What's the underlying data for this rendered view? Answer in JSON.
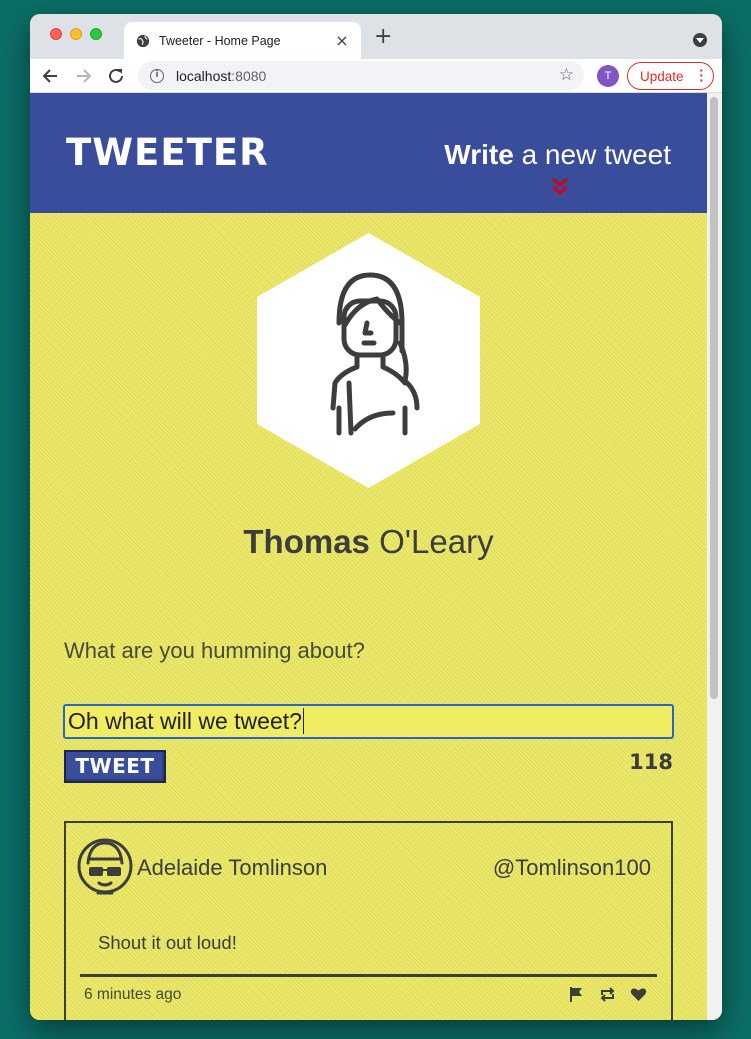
{
  "browser": {
    "tab_title": "Tweeter - Home Page",
    "tab_close": "×",
    "new_tab": "+",
    "url_host": "localhost",
    "url_port": ":8080",
    "info_glyph": "i",
    "star_glyph": "☆",
    "profile_initial": "T",
    "update_label": "Update",
    "update_menu": "⋮"
  },
  "header": {
    "logo": "TWEETER",
    "write_bold": "Write",
    "write_rest": " a new tweet",
    "chevron_icon": "double-chevron-down-icon",
    "chevron_color": "#d0021b"
  },
  "profile": {
    "first_name": "Thomas",
    "last_name": " O'Leary"
  },
  "compose": {
    "label": "What are you humming about?",
    "value": "Oh what will we tweet?",
    "button_label": "TWEET",
    "char_count": "118"
  },
  "tweets": [
    {
      "author": "Adelaide Tomlinson",
      "handle": "@Tomlinson100",
      "body": "Shout it out loud!",
      "time": "6 minutes ago",
      "actions": [
        "flag-icon",
        "retweet-icon",
        "heart-icon"
      ]
    }
  ],
  "colors": {
    "header_bg": "#3a4d9a",
    "page_bg": "#ebe865",
    "text": "#3d3d3d",
    "accent_red": "#d0021b"
  }
}
